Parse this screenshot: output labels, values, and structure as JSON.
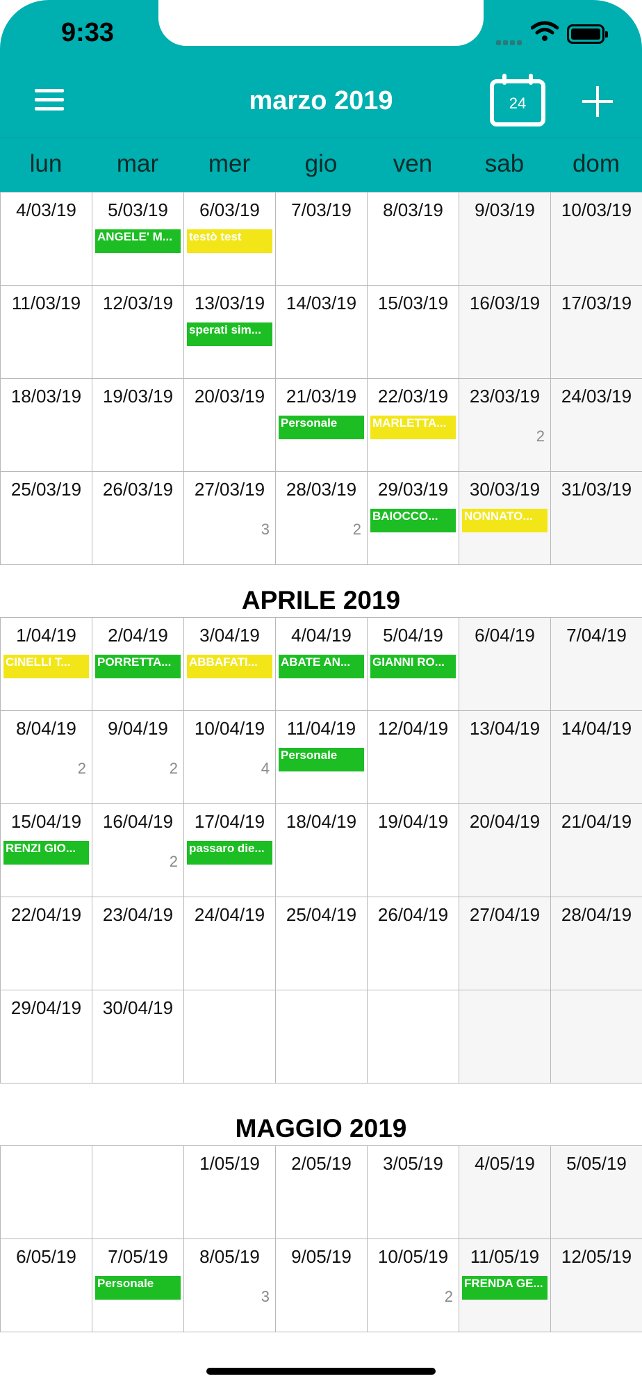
{
  "status": {
    "time": "9:33"
  },
  "navbar": {
    "title": "marzo 2019",
    "today_number": "24"
  },
  "weekdays": [
    "lun",
    "mar",
    "mer",
    "gio",
    "ven",
    "sab",
    "dom"
  ],
  "colors": {
    "teal": "#00AFAF",
    "green": "#1DBE24",
    "yellow": "#F2E619",
    "weekend_bg": "#F6F6F6"
  },
  "months": [
    {
      "title": "",
      "weeks": [
        [
          {
            "date": "4/03/19"
          },
          {
            "date": "5/03/19",
            "event": {
              "label": "ANGELE' M...",
              "color": "green"
            }
          },
          {
            "date": "6/03/19",
            "event": {
              "label": "testò test",
              "color": "yellow"
            }
          },
          {
            "date": "7/03/19"
          },
          {
            "date": "8/03/19"
          },
          {
            "date": "9/03/19"
          },
          {
            "date": "10/03/19"
          }
        ],
        [
          {
            "date": "11/03/19"
          },
          {
            "date": "12/03/19"
          },
          {
            "date": "13/03/19",
            "event": {
              "label": "sperati sim...",
              "color": "green"
            }
          },
          {
            "date": "14/03/19"
          },
          {
            "date": "15/03/19"
          },
          {
            "date": "16/03/19"
          },
          {
            "date": "17/03/19"
          }
        ],
        [
          {
            "date": "18/03/19"
          },
          {
            "date": "19/03/19"
          },
          {
            "date": "20/03/19"
          },
          {
            "date": "21/03/19",
            "event": {
              "label": "Personale",
              "color": "green"
            }
          },
          {
            "date": "22/03/19",
            "event": {
              "label": "MARLETTA...",
              "color": "yellow"
            }
          },
          {
            "date": "23/03/19",
            "more": "2"
          },
          {
            "date": "24/03/19"
          }
        ],
        [
          {
            "date": "25/03/19"
          },
          {
            "date": "26/03/19"
          },
          {
            "date": "27/03/19",
            "more": "3"
          },
          {
            "date": "28/03/19",
            "more": "2"
          },
          {
            "date": "29/03/19",
            "event": {
              "label": "BAIOCCO...",
              "color": "green"
            }
          },
          {
            "date": "30/03/19",
            "event": {
              "label": "NONNATO...",
              "color": "yellow"
            }
          },
          {
            "date": "31/03/19"
          }
        ]
      ]
    },
    {
      "title": "APRILE 2019",
      "weeks": [
        [
          {
            "date": "1/04/19",
            "event": {
              "label": "CINELLI T...",
              "color": "yellow"
            }
          },
          {
            "date": "2/04/19",
            "event": {
              "label": "PORRETTA...",
              "color": "green"
            }
          },
          {
            "date": "3/04/19",
            "event": {
              "label": "ABBAFATI...",
              "color": "yellow"
            }
          },
          {
            "date": "4/04/19",
            "event": {
              "label": "ABATE AN...",
              "color": "green"
            }
          },
          {
            "date": "5/04/19",
            "event": {
              "label": "GIANNI RO...",
              "color": "green"
            }
          },
          {
            "date": "6/04/19"
          },
          {
            "date": "7/04/19"
          }
        ],
        [
          {
            "date": "8/04/19",
            "more": "2"
          },
          {
            "date": "9/04/19",
            "more": "2"
          },
          {
            "date": "10/04/19",
            "more": "4"
          },
          {
            "date": "11/04/19",
            "event": {
              "label": "Personale",
              "color": "green"
            }
          },
          {
            "date": "12/04/19"
          },
          {
            "date": "13/04/19"
          },
          {
            "date": "14/04/19"
          }
        ],
        [
          {
            "date": "15/04/19",
            "event": {
              "label": "RENZI GIO...",
              "color": "green"
            }
          },
          {
            "date": "16/04/19",
            "more": "2"
          },
          {
            "date": "17/04/19",
            "event": {
              "label": "passaro die...",
              "color": "green"
            }
          },
          {
            "date": "18/04/19"
          },
          {
            "date": "19/04/19"
          },
          {
            "date": "20/04/19"
          },
          {
            "date": "21/04/19"
          }
        ],
        [
          {
            "date": "22/04/19"
          },
          {
            "date": "23/04/19"
          },
          {
            "date": "24/04/19"
          },
          {
            "date": "25/04/19"
          },
          {
            "date": "26/04/19"
          },
          {
            "date": "27/04/19"
          },
          {
            "date": "28/04/19"
          }
        ],
        [
          {
            "date": "29/04/19"
          },
          {
            "date": "30/04/19"
          },
          {
            "date": ""
          },
          {
            "date": ""
          },
          {
            "date": ""
          },
          {
            "date": ""
          },
          {
            "date": ""
          }
        ]
      ]
    },
    {
      "title": "MAGGIO 2019",
      "weeks": [
        [
          {
            "date": ""
          },
          {
            "date": ""
          },
          {
            "date": "1/05/19"
          },
          {
            "date": "2/05/19"
          },
          {
            "date": "3/05/19"
          },
          {
            "date": "4/05/19"
          },
          {
            "date": "5/05/19"
          }
        ],
        [
          {
            "date": "6/05/19"
          },
          {
            "date": "7/05/19",
            "event": {
              "label": "Personale",
              "color": "green"
            }
          },
          {
            "date": "8/05/19",
            "more": "3"
          },
          {
            "date": "9/05/19"
          },
          {
            "date": "10/05/19",
            "more": "2"
          },
          {
            "date": "11/05/19",
            "event": {
              "label": "FRENDA GE...",
              "color": "green"
            }
          },
          {
            "date": "12/05/19"
          }
        ]
      ]
    }
  ]
}
